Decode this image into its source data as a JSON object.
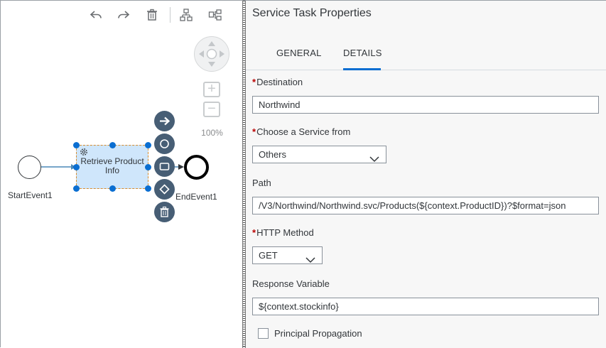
{
  "toolbar": {
    "icons": [
      "undo-icon",
      "redo-icon",
      "delete-icon",
      "auto-layout-icon",
      "toggle-layout-icon"
    ]
  },
  "navigator": {
    "zoom_in": "+",
    "zoom_out": "−",
    "zoom_level": "100%"
  },
  "diagram": {
    "start_event_label": "StartEvent1",
    "task_label": "Retrieve Product Info",
    "end_event_label": "EndEvent1",
    "quick_actions": [
      "connect-arrow-icon",
      "event-circle-icon",
      "task-rectangle-icon",
      "gateway-diamond-icon",
      "trash-icon"
    ]
  },
  "panel": {
    "title": "Service Task Properties",
    "tabs": [
      {
        "label": "GENERAL",
        "active": false
      },
      {
        "label": "DETAILS",
        "active": true
      }
    ],
    "fields": {
      "destination": {
        "label": "Destination",
        "required": true,
        "value": "Northwind"
      },
      "service_from": {
        "label": "Choose a Service from",
        "required": true,
        "value": "Others"
      },
      "path": {
        "label": "Path",
        "required": false,
        "value": "/V3/Northwind/Northwind.svc/Products(${context.ProductID})?$format=json"
      },
      "http_method": {
        "label": "HTTP Method",
        "required": true,
        "value": "GET"
      },
      "response_variable": {
        "label": "Response Variable",
        "required": false,
        "value": "${context.stockinfo}"
      }
    },
    "principal_propagation": {
      "label": "Principal Propagation",
      "checked": false
    },
    "required_marker": "*"
  },
  "colors": {
    "accent": "#0a6ed1",
    "required": "#bb0000",
    "task_fill": "#cfe6fb",
    "quick_action_bg": "#475e75"
  }
}
